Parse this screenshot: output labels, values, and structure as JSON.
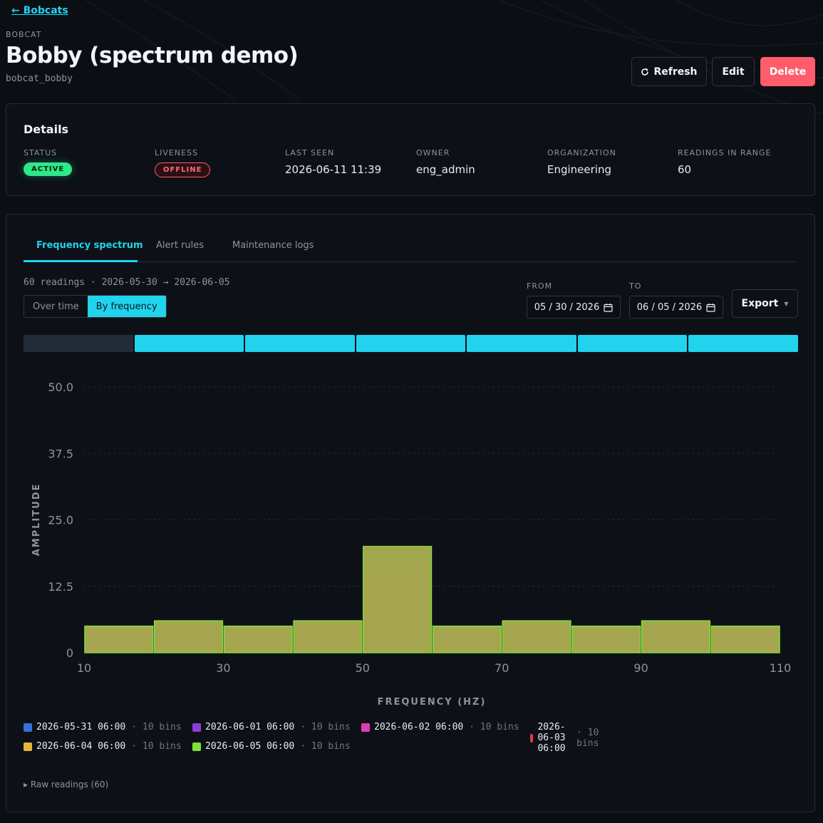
{
  "nav": {
    "back_label": "← Bobcats"
  },
  "header": {
    "eyebrow": "BOBCAT",
    "title": "Bobby (spectrum demo)",
    "slug": "bobcat_bobby",
    "refresh_label": "Refresh",
    "edit_label": "Edit",
    "delete_label": "Delete"
  },
  "details": {
    "title": "Details",
    "status": {
      "label": "STATUS",
      "value": "ACTIVE"
    },
    "liveness": {
      "label": "LIVENESS",
      "value": "OFFLINE"
    },
    "last_seen": {
      "label": "LAST SEEN",
      "value": "2026-06-11 11:39"
    },
    "owner": {
      "label": "OWNER",
      "value": "eng_admin"
    },
    "organization": {
      "label": "ORGANIZATION",
      "value": "Engineering"
    },
    "readings": {
      "label": "READINGS IN RANGE",
      "value": "60"
    }
  },
  "tabs": [
    {
      "label": "Frequency spectrum"
    },
    {
      "label": "Alert rules"
    },
    {
      "label": "Maintenance logs"
    }
  ],
  "toolbar": {
    "summary": "60 readings · 2026-05-30 → 2026-06-05",
    "view_over_time": "Over time",
    "view_by_frequency": "By frequency",
    "from_label": "FROM",
    "from_value": "05 / 30 / 2026",
    "to_label": "TO",
    "to_value": "06 / 05 / 2026",
    "export_label": "Export"
  },
  "timeline": [
    0,
    1,
    1,
    1,
    1,
    1,
    1
  ],
  "colors": {
    "accent": "#22d3ee",
    "bar_fill": "#a6a550",
    "bar_stroke": "#7ee03a",
    "danger": "#ff5c6c",
    "success": "#2ee88a"
  },
  "chart_data": {
    "type": "bar",
    "xlabel": "FREQUENCY (HZ)",
    "ylabel": "AMPLITUDE",
    "xlim": [
      10,
      110
    ],
    "ylim": [
      0,
      50
    ],
    "x_ticks": [
      10,
      30,
      50,
      70,
      90,
      110
    ],
    "y_ticks": [
      "0",
      "12.5",
      "25.0",
      "37.5",
      "50.0"
    ],
    "bins": [
      {
        "x0": 10,
        "x1": 20,
        "value": 5
      },
      {
        "x0": 20,
        "x1": 30,
        "value": 6
      },
      {
        "x0": 30,
        "x1": 40,
        "value": 5
      },
      {
        "x0": 40,
        "x1": 50,
        "value": 6
      },
      {
        "x0": 50,
        "x1": 60,
        "value": 20
      },
      {
        "x0": 60,
        "x1": 70,
        "value": 5
      },
      {
        "x0": 70,
        "x1": 80,
        "value": 6
      },
      {
        "x0": 80,
        "x1": 90,
        "value": 5
      },
      {
        "x0": 90,
        "x1": 100,
        "value": 6
      },
      {
        "x0": 100,
        "x1": 110,
        "value": 5
      }
    ],
    "peak_layers": [
      20,
      19.2,
      18.5,
      18,
      17.4
    ],
    "grid": true
  },
  "legend": [
    {
      "name": "2026-05-31 06:00",
      "bins": "· 10 bins",
      "color": "#3b6fd8"
    },
    {
      "name": "2026-06-01 06:00",
      "bins": "· 10 bins",
      "color": "#8b3fd8"
    },
    {
      "name": "2026-06-02 06:00",
      "bins": "· 10 bins",
      "color": "#d83fb0"
    },
    {
      "name": "2026-06-03 06:00",
      "bins": "· 10 bins",
      "color": "#d83f3f"
    },
    {
      "name": "2026-06-04 06:00",
      "bins": "· 10 bins",
      "color": "#e6b53a"
    },
    {
      "name": "2026-06-05 06:00",
      "bins": "· 10 bins",
      "color": "#7ee03a"
    }
  ],
  "raw_readings_label": "▸ Raw readings (60)"
}
